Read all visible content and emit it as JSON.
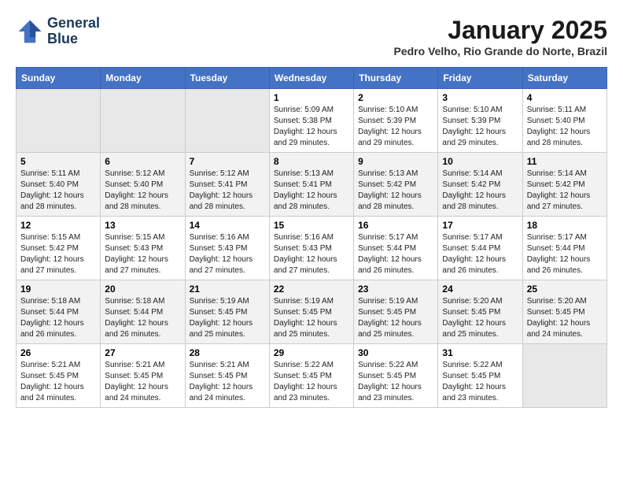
{
  "logo": {
    "line1": "General",
    "line2": "Blue"
  },
  "title": "January 2025",
  "subtitle": "Pedro Velho, Rio Grande do Norte, Brazil",
  "weekdays": [
    "Sunday",
    "Monday",
    "Tuesday",
    "Wednesday",
    "Thursday",
    "Friday",
    "Saturday"
  ],
  "weeks": [
    [
      {
        "day": "",
        "sunrise": "",
        "sunset": "",
        "daylight": ""
      },
      {
        "day": "",
        "sunrise": "",
        "sunset": "",
        "daylight": ""
      },
      {
        "day": "",
        "sunrise": "",
        "sunset": "",
        "daylight": ""
      },
      {
        "day": "1",
        "sunrise": "Sunrise: 5:09 AM",
        "sunset": "Sunset: 5:38 PM",
        "daylight": "Daylight: 12 hours and 29 minutes."
      },
      {
        "day": "2",
        "sunrise": "Sunrise: 5:10 AM",
        "sunset": "Sunset: 5:39 PM",
        "daylight": "Daylight: 12 hours and 29 minutes."
      },
      {
        "day": "3",
        "sunrise": "Sunrise: 5:10 AM",
        "sunset": "Sunset: 5:39 PM",
        "daylight": "Daylight: 12 hours and 29 minutes."
      },
      {
        "day": "4",
        "sunrise": "Sunrise: 5:11 AM",
        "sunset": "Sunset: 5:40 PM",
        "daylight": "Daylight: 12 hours and 28 minutes."
      }
    ],
    [
      {
        "day": "5",
        "sunrise": "Sunrise: 5:11 AM",
        "sunset": "Sunset: 5:40 PM",
        "daylight": "Daylight: 12 hours and 28 minutes."
      },
      {
        "day": "6",
        "sunrise": "Sunrise: 5:12 AM",
        "sunset": "Sunset: 5:40 PM",
        "daylight": "Daylight: 12 hours and 28 minutes."
      },
      {
        "day": "7",
        "sunrise": "Sunrise: 5:12 AM",
        "sunset": "Sunset: 5:41 PM",
        "daylight": "Daylight: 12 hours and 28 minutes."
      },
      {
        "day": "8",
        "sunrise": "Sunrise: 5:13 AM",
        "sunset": "Sunset: 5:41 PM",
        "daylight": "Daylight: 12 hours and 28 minutes."
      },
      {
        "day": "9",
        "sunrise": "Sunrise: 5:13 AM",
        "sunset": "Sunset: 5:42 PM",
        "daylight": "Daylight: 12 hours and 28 minutes."
      },
      {
        "day": "10",
        "sunrise": "Sunrise: 5:14 AM",
        "sunset": "Sunset: 5:42 PM",
        "daylight": "Daylight: 12 hours and 28 minutes."
      },
      {
        "day": "11",
        "sunrise": "Sunrise: 5:14 AM",
        "sunset": "Sunset: 5:42 PM",
        "daylight": "Daylight: 12 hours and 27 minutes."
      }
    ],
    [
      {
        "day": "12",
        "sunrise": "Sunrise: 5:15 AM",
        "sunset": "Sunset: 5:42 PM",
        "daylight": "Daylight: 12 hours and 27 minutes."
      },
      {
        "day": "13",
        "sunrise": "Sunrise: 5:15 AM",
        "sunset": "Sunset: 5:43 PM",
        "daylight": "Daylight: 12 hours and 27 minutes."
      },
      {
        "day": "14",
        "sunrise": "Sunrise: 5:16 AM",
        "sunset": "Sunset: 5:43 PM",
        "daylight": "Daylight: 12 hours and 27 minutes."
      },
      {
        "day": "15",
        "sunrise": "Sunrise: 5:16 AM",
        "sunset": "Sunset: 5:43 PM",
        "daylight": "Daylight: 12 hours and 27 minutes."
      },
      {
        "day": "16",
        "sunrise": "Sunrise: 5:17 AM",
        "sunset": "Sunset: 5:44 PM",
        "daylight": "Daylight: 12 hours and 26 minutes."
      },
      {
        "day": "17",
        "sunrise": "Sunrise: 5:17 AM",
        "sunset": "Sunset: 5:44 PM",
        "daylight": "Daylight: 12 hours and 26 minutes."
      },
      {
        "day": "18",
        "sunrise": "Sunrise: 5:17 AM",
        "sunset": "Sunset: 5:44 PM",
        "daylight": "Daylight: 12 hours and 26 minutes."
      }
    ],
    [
      {
        "day": "19",
        "sunrise": "Sunrise: 5:18 AM",
        "sunset": "Sunset: 5:44 PM",
        "daylight": "Daylight: 12 hours and 26 minutes."
      },
      {
        "day": "20",
        "sunrise": "Sunrise: 5:18 AM",
        "sunset": "Sunset: 5:44 PM",
        "daylight": "Daylight: 12 hours and 26 minutes."
      },
      {
        "day": "21",
        "sunrise": "Sunrise: 5:19 AM",
        "sunset": "Sunset: 5:45 PM",
        "daylight": "Daylight: 12 hours and 25 minutes."
      },
      {
        "day": "22",
        "sunrise": "Sunrise: 5:19 AM",
        "sunset": "Sunset: 5:45 PM",
        "daylight": "Daylight: 12 hours and 25 minutes."
      },
      {
        "day": "23",
        "sunrise": "Sunrise: 5:19 AM",
        "sunset": "Sunset: 5:45 PM",
        "daylight": "Daylight: 12 hours and 25 minutes."
      },
      {
        "day": "24",
        "sunrise": "Sunrise: 5:20 AM",
        "sunset": "Sunset: 5:45 PM",
        "daylight": "Daylight: 12 hours and 25 minutes."
      },
      {
        "day": "25",
        "sunrise": "Sunrise: 5:20 AM",
        "sunset": "Sunset: 5:45 PM",
        "daylight": "Daylight: 12 hours and 24 minutes."
      }
    ],
    [
      {
        "day": "26",
        "sunrise": "Sunrise: 5:21 AM",
        "sunset": "Sunset: 5:45 PM",
        "daylight": "Daylight: 12 hours and 24 minutes."
      },
      {
        "day": "27",
        "sunrise": "Sunrise: 5:21 AM",
        "sunset": "Sunset: 5:45 PM",
        "daylight": "Daylight: 12 hours and 24 minutes."
      },
      {
        "day": "28",
        "sunrise": "Sunrise: 5:21 AM",
        "sunset": "Sunset: 5:45 PM",
        "daylight": "Daylight: 12 hours and 24 minutes."
      },
      {
        "day": "29",
        "sunrise": "Sunrise: 5:22 AM",
        "sunset": "Sunset: 5:45 PM",
        "daylight": "Daylight: 12 hours and 23 minutes."
      },
      {
        "day": "30",
        "sunrise": "Sunrise: 5:22 AM",
        "sunset": "Sunset: 5:45 PM",
        "daylight": "Daylight: 12 hours and 23 minutes."
      },
      {
        "day": "31",
        "sunrise": "Sunrise: 5:22 AM",
        "sunset": "Sunset: 5:45 PM",
        "daylight": "Daylight: 12 hours and 23 minutes."
      },
      {
        "day": "",
        "sunrise": "",
        "sunset": "",
        "daylight": ""
      }
    ]
  ]
}
